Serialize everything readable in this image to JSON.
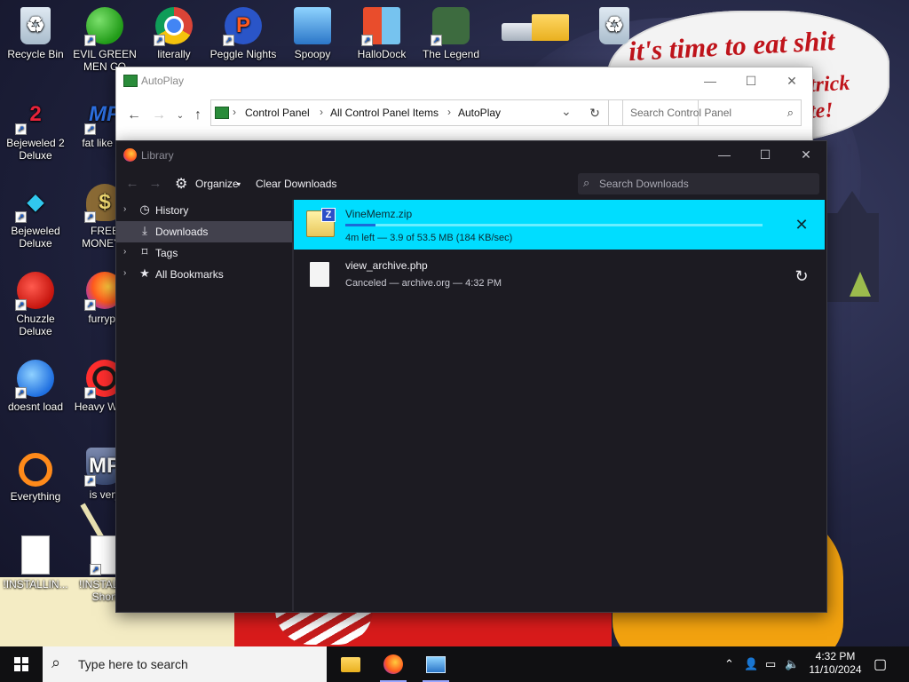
{
  "desktop": {
    "speech_bubble": {
      "line1": "it's time to eat shit",
      "line2": "trick",
      "line3": "te!"
    },
    "icons": [
      {
        "label": "Recycle Bin",
        "icon": "recycle-bin-icon"
      },
      {
        "label": "EVIL GREEN MEN CO",
        "icon": "people-icon"
      },
      {
        "label": "literally",
        "icon": "chrome-icon"
      },
      {
        "label": "Peggle Nights",
        "icon": "peggle-icon"
      },
      {
        "label": "Spoopy",
        "icon": "network-computers-icon"
      },
      {
        "label": "HalloDock",
        "icon": "hallodock-icon"
      },
      {
        "label": "The Legend",
        "icon": "legend-icon"
      },
      {
        "label": "Bejeweled 2 Deluxe",
        "icon": "bejeweled2-icon"
      },
      {
        "label": "fat like da",
        "icon": "mp-game-icon"
      },
      {
        "label": "Bejeweled Deluxe",
        "icon": "diamond-icon"
      },
      {
        "label": "FREE MONEY.c",
        "icon": "money-bag-icon"
      },
      {
        "label": "Chuzzle Deluxe",
        "icon": "chuzzle-icon"
      },
      {
        "label": "furrypo",
        "icon": "firefox-icon"
      },
      {
        "label": "doesnt load",
        "icon": "thunderbird-icon"
      },
      {
        "label": "Heavy Weap",
        "icon": "radiation-icon"
      },
      {
        "label": "Everything",
        "icon": "everything-search-icon"
      },
      {
        "label": "is very",
        "icon": "shield-game-icon"
      },
      {
        "label": "!INSTALLIN...",
        "icon": "text-document-icon"
      },
      {
        "label": "!INSTALL - Short",
        "icon": "text-document-icon"
      }
    ]
  },
  "autoplay_window": {
    "title": "AutoPlay",
    "breadcrumbs": [
      "Control Panel",
      "All Control Panel Items",
      "AutoPlay"
    ],
    "search_placeholder": "Search Control Panel",
    "controls": {
      "minimize": "—",
      "maximize": "☐",
      "close": "✕"
    }
  },
  "library_window": {
    "title": "Library",
    "controls": {
      "minimize": "—",
      "maximize": "☐",
      "close": "✕"
    },
    "toolbar": {
      "organize": "Organize",
      "clear_downloads": "Clear Downloads",
      "search_placeholder": "Search Downloads"
    },
    "sidebar": [
      {
        "label": "History",
        "icon": "clock-icon",
        "expandable": true,
        "selected": false
      },
      {
        "label": "Downloads",
        "icon": "download-icon",
        "expandable": false,
        "selected": true
      },
      {
        "label": "Tags",
        "icon": "tag-icon",
        "expandable": true,
        "selected": false
      },
      {
        "label": "All Bookmarks",
        "icon": "star-icon",
        "expandable": true,
        "selected": false
      }
    ],
    "downloads": [
      {
        "name": "VineMemz.zip",
        "status": "4m left — 3.9 of 53.5 MB (184 KB/sec)",
        "progress": 0.073,
        "icon": "zip-file-icon",
        "action": "cancel"
      },
      {
        "name": "view_archive.php",
        "status": "Canceled — archive.org — 4:32 PM",
        "icon": "file-icon",
        "action": "retry"
      }
    ]
  },
  "taskbar": {
    "search_placeholder": "Type here to search",
    "apps": [
      "file-explorer-icon",
      "firefox-icon",
      "control-panel-icon"
    ],
    "time": "4:32 PM",
    "date": "11/10/2024"
  },
  "colors": {
    "library_bg": "#1c1b22",
    "active_download": "#00ddff",
    "progress_fill": "#1b6bd8",
    "sidebar_selected": "#42414d",
    "taskbar": "#101012"
  }
}
